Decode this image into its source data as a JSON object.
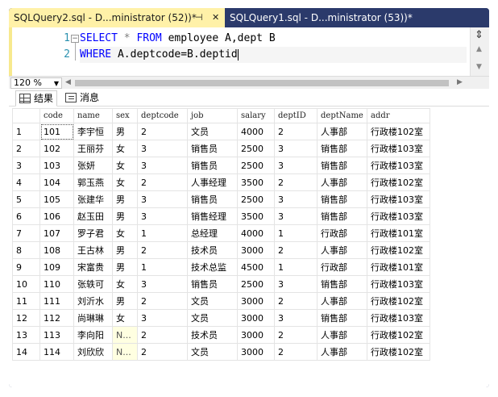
{
  "tabs": [
    {
      "label": "SQLQuery2.sql - D...ministrator (52))*",
      "pin": "⊣",
      "close": "✕"
    },
    {
      "label": "SQLQuery1.sql - D...ministrator (53))*"
    }
  ],
  "editor": {
    "line_numbers": [
      "1",
      "2"
    ],
    "line1": {
      "kw1": "SELECT",
      "star": " * ",
      "kw2": "FROM",
      "rest": " employee A,dept B"
    },
    "line2": {
      "kw": "WHERE",
      "rest": " A.deptcode=B.deptid"
    }
  },
  "zoom": {
    "value": "120 %"
  },
  "results_tabs": {
    "results": "结果",
    "messages": "消息"
  },
  "table": {
    "columns": [
      "code",
      "name",
      "sex",
      "deptcode",
      "job",
      "salary",
      "deptID",
      "deptName",
      "addr"
    ],
    "rows": [
      [
        "1",
        "101",
        "李宇恒",
        "男",
        "2",
        "文员",
        "4000",
        "2",
        "人事部",
        "行政楼102室"
      ],
      [
        "2",
        "102",
        "王丽芬",
        "女",
        "3",
        "销售员",
        "2500",
        "3",
        "销售部",
        "行政楼103室"
      ],
      [
        "3",
        "103",
        "张妍",
        "女",
        "3",
        "销售员",
        "2500",
        "3",
        "销售部",
        "行政楼103室"
      ],
      [
        "4",
        "104",
        "郭玉燕",
        "女",
        "2",
        "人事经理",
        "3500",
        "2",
        "人事部",
        "行政楼102室"
      ],
      [
        "5",
        "105",
        "张建华",
        "男",
        "3",
        "销售员",
        "2500",
        "3",
        "销售部",
        "行政楼103室"
      ],
      [
        "6",
        "106",
        "赵玉田",
        "男",
        "3",
        "销售经理",
        "3500",
        "3",
        "销售部",
        "行政楼103室"
      ],
      [
        "7",
        "107",
        "罗子君",
        "女",
        "1",
        "总经理",
        "4000",
        "1",
        "行政部",
        "行政楼101室"
      ],
      [
        "8",
        "108",
        "王古林",
        "男",
        "2",
        "技术员",
        "3000",
        "2",
        "人事部",
        "行政楼102室"
      ],
      [
        "9",
        "109",
        "宋富贵",
        "男",
        "1",
        "技术总监",
        "4500",
        "1",
        "行政部",
        "行政楼101室"
      ],
      [
        "10",
        "110",
        "张轶可",
        "女",
        "3",
        "销售员",
        "2500",
        "3",
        "销售部",
        "行政楼103室"
      ],
      [
        "11",
        "111",
        "刘沂水",
        "男",
        "2",
        "文员",
        "3000",
        "2",
        "人事部",
        "行政楼102室"
      ],
      [
        "12",
        "112",
        "尚琳琳",
        "女",
        "3",
        "文员",
        "3000",
        "3",
        "销售部",
        "行政楼103室"
      ],
      [
        "13",
        "113",
        "李向阳",
        "N...",
        "2",
        "技术员",
        "3000",
        "2",
        "人事部",
        "行政楼102室"
      ],
      [
        "14",
        "114",
        "刘欣欣",
        "N...",
        "2",
        "文员",
        "3000",
        "2",
        "人事部",
        "行政楼102室"
      ]
    ]
  },
  "colors": {
    "frame": "#2b3a6b",
    "active_tab": "#fff1a8",
    "keyword": "#0000ff",
    "line_number": "#2b91af",
    "null_cell": "#ffffe1"
  }
}
